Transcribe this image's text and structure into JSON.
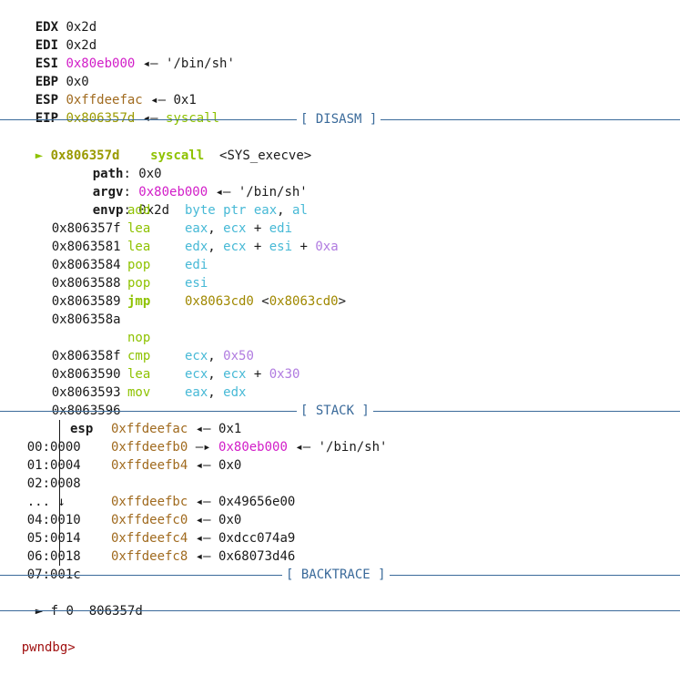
{
  "registers": [
    {
      "name": "EDX",
      "value": "0x2d",
      "annotation": ""
    },
    {
      "name": "EDI",
      "value": "0x2d",
      "annotation": ""
    },
    {
      "name": "ESI",
      "value": "0x80eb000",
      "annotation": "◂— '/bin/sh'"
    },
    {
      "name": "EBP",
      "value": "0x0",
      "annotation": ""
    },
    {
      "name": "ESP",
      "value": "0xffdeefac",
      "annotation": "◂— 0x1"
    },
    {
      "name": "EIP",
      "value": "0x806357d",
      "arrow": "◂—",
      "target": "syscall"
    }
  ],
  "disasm": {
    "header": "[ DISASM ]",
    "current": {
      "marker": "►",
      "addr": "0x806357d",
      "mnemonic": "syscall",
      "operand": "<SYS_execve>"
    },
    "args": [
      {
        "name": "path",
        "value": "0x0",
        "annotation": ""
      },
      {
        "name": "argv",
        "value": "0x80eb000",
        "annotation": "◂— '/bin/sh'"
      },
      {
        "name": "envp",
        "value": "0x2d",
        "annotation": ""
      }
    ],
    "instructions": [
      {
        "addr": "0x806357f",
        "mnemonic": "add",
        "ops": [
          "byte ptr ",
          "eax",
          ", ",
          "al"
        ]
      },
      {
        "addr": "0x8063581",
        "mnemonic": "lea",
        "ops": [
          "eax",
          ", ",
          "ecx",
          " + ",
          "edi"
        ]
      },
      {
        "addr": "0x8063584",
        "mnemonic": "lea",
        "ops": [
          "edx",
          ", ",
          "ecx",
          " + ",
          "esi",
          " + ",
          "0xa"
        ]
      },
      {
        "addr": "0x8063588",
        "mnemonic": "pop",
        "ops": [
          "edi"
        ]
      },
      {
        "addr": "0x8063589",
        "mnemonic": "pop",
        "ops": [
          "esi"
        ]
      },
      {
        "addr": "0x806358a",
        "mnemonic": "jmp",
        "target": "0x8063cd0",
        "label": "<0x8063cd0>"
      },
      {
        "addr": "0x806358f",
        "mnemonic": "nop",
        "ops": []
      },
      {
        "addr": "0x8063590",
        "mnemonic": "cmp",
        "ops": [
          "ecx",
          ", ",
          "0x50"
        ]
      },
      {
        "addr": "0x8063593",
        "mnemonic": "lea",
        "ops": [
          "ecx",
          ", ",
          "ecx",
          " + ",
          "0x30"
        ]
      },
      {
        "addr": "0x8063596",
        "mnemonic": "mov",
        "ops": [
          "eax",
          ", ",
          "edx"
        ]
      }
    ]
  },
  "stack": {
    "header": "[ STACK ]",
    "rows": [
      {
        "idx": "00:0000",
        "reg": "esp",
        "addr": "0xffdeefac",
        "rest": "◂— 0x1"
      },
      {
        "idx": "01:0004",
        "reg": "",
        "addr": "0xffdeefb0",
        "arrow": "—▸",
        "ptr": "0x80eb000",
        "rest": "◂— '/bin/sh'"
      },
      {
        "idx": "02:0008",
        "reg": "",
        "addr": "0xffdeefb4",
        "rest": "◂— 0x0"
      },
      {
        "idx": "... ↓",
        "reg": "",
        "addr": "",
        "rest": ""
      },
      {
        "idx": "04:0010",
        "reg": "",
        "addr": "0xffdeefbc",
        "rest": "◂— 0x49656e00"
      },
      {
        "idx": "05:0014",
        "reg": "",
        "addr": "0xffdeefc0",
        "rest": "◂— 0x0"
      },
      {
        "idx": "06:0018",
        "reg": "",
        "addr": "0xffdeefc4",
        "rest": "◂— 0xdcc074a9"
      },
      {
        "idx": "07:001c",
        "reg": "",
        "addr": "0xffdeefc8",
        "rest": "◂— 0x68073d46"
      }
    ]
  },
  "backtrace": {
    "header": "[ BACKTRACE ]",
    "frames": [
      {
        "marker": "►",
        "frame": "f 0",
        "addr": "806357d"
      }
    ]
  },
  "prompt": {
    "text": "pwndbg>"
  }
}
